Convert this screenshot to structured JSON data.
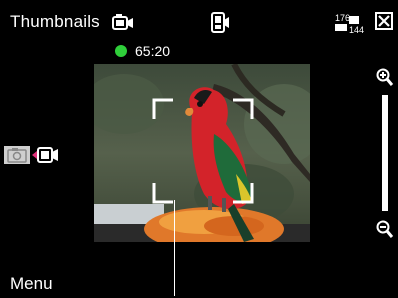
{
  "topbar": {
    "title": "Thumbnails",
    "icons": [
      "video-camera-icon",
      "camcorder-mode-icon",
      "resolution-icon",
      "close-icon"
    ],
    "resolution_top": "176",
    "resolution_bottom": "144"
  },
  "status": {
    "recording_time": "65:20",
    "recording_indicator_color": "#2fcf3a"
  },
  "viewfinder": {
    "subject": "parrot-preview"
  },
  "zoom": {
    "icons": [
      "zoom-in-icon",
      "zoom-out-icon"
    ]
  },
  "mode_switch": {
    "icons": [
      "camera-icon",
      "video-camera-icon"
    ]
  },
  "softkeys": {
    "left": "Menu"
  }
}
